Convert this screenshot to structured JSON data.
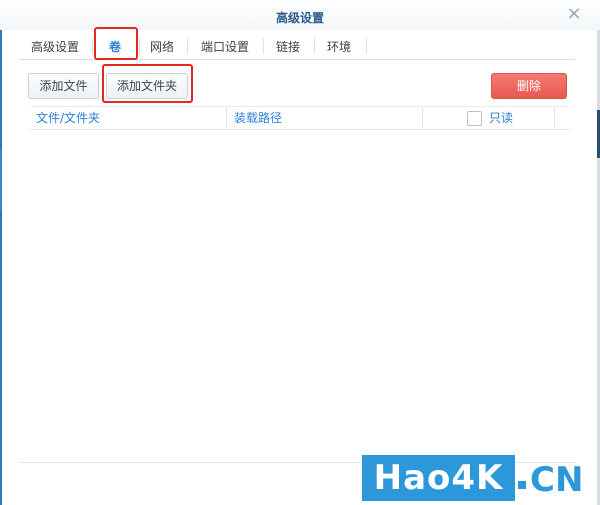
{
  "window": {
    "title": "高级设置",
    "close_glyph": "×"
  },
  "tabs": [
    {
      "label": "高级设置",
      "active": false
    },
    {
      "label": "卷",
      "active": true
    },
    {
      "label": "网络",
      "active": false
    },
    {
      "label": "端口设置",
      "active": false
    },
    {
      "label": "链接",
      "active": false
    },
    {
      "label": "环境",
      "active": false
    }
  ],
  "toolbar": {
    "add_file_label": "添加文件",
    "add_folder_label": "添加文件夹",
    "delete_label": "删除"
  },
  "table": {
    "columns": [
      "文件/文件夹",
      "装载路径",
      "只读"
    ],
    "readonly_checked": false,
    "rows": []
  },
  "watermark": {
    "brand": "Hao4K",
    "tld": "CN"
  },
  "colors": {
    "accent": "#2e7fd6",
    "danger": "#e85a50",
    "highlight": "#e5271f",
    "watermark": "#2c97da"
  }
}
